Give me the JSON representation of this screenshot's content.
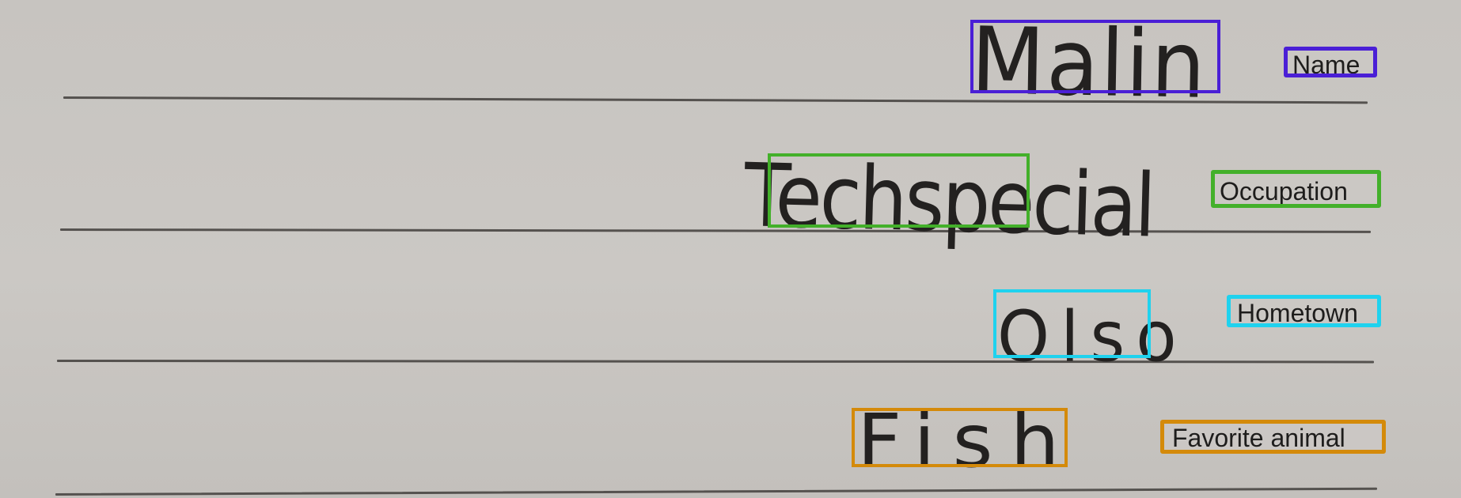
{
  "fields": [
    {
      "id": "name",
      "label": "Name",
      "value": "Malin",
      "color": "#4a1fd6"
    },
    {
      "id": "occupation",
      "label": "Occupation",
      "value": "Techspecial",
      "color": "#43b02a"
    },
    {
      "id": "hometown",
      "label": "Hometown",
      "value": "Olso",
      "color": "#1fd2ee"
    },
    {
      "id": "favorite-animal",
      "label": "Favorite animal",
      "value": "Fish",
      "color": "#d48a0a"
    }
  ]
}
